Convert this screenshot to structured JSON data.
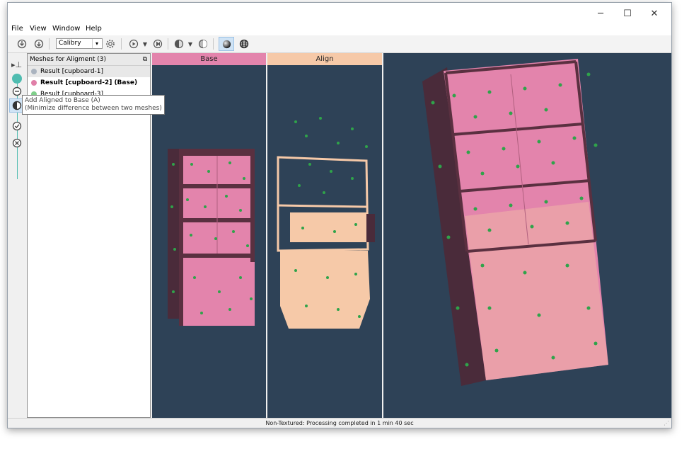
{
  "window": {
    "minimize_glyph": "─",
    "maximize_glyph": "☐",
    "close_glyph": "✕"
  },
  "menu": [
    "File",
    "View",
    "Window",
    "Help"
  ],
  "toolbar": {
    "font_value": "Calibry",
    "icons": [
      "import-icon",
      "export-icon",
      "font-select",
      "gear-icon",
      "play-icon",
      "dropdown-arrow-icon",
      "next-icon",
      "shading-icon",
      "dropdown-arrow-icon",
      "mesh-icon",
      "sphere-icon",
      "globe-icon"
    ]
  },
  "panel": {
    "title": "Meshes for Aligment (3)",
    "items": [
      {
        "label": "Result [cupboard-1]",
        "color": "#aab3bf",
        "bold": false
      },
      {
        "label": "Result [cupboard-2] (Base)",
        "color": "#e07fa8",
        "bold": true
      },
      {
        "label": "Result [cupboard-3]",
        "color": "#7fcf8a",
        "bold": false
      }
    ]
  },
  "tooltip": {
    "line1": "Add Aligned to Base (A)",
    "line2": "(Minimize difference between two meshes)"
  },
  "views": {
    "base_label": "Base",
    "align_label": "Align",
    "base_color": "#e384ac",
    "align_color": "#f6c9a8",
    "background": "#2e4257"
  },
  "status": "Non-Textured: Processing completed in 1 min 40 sec"
}
